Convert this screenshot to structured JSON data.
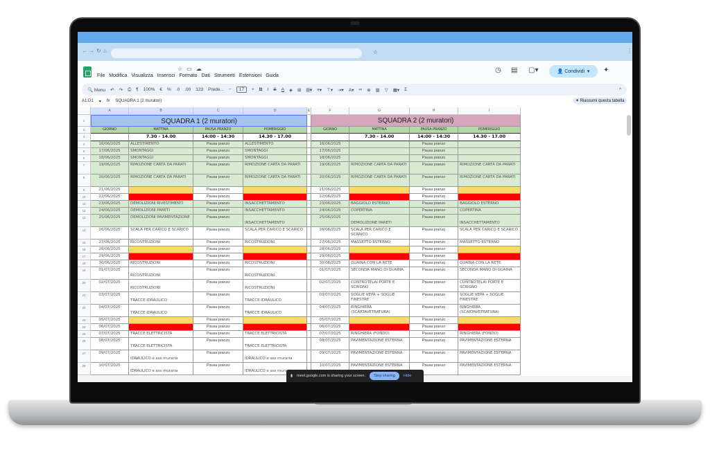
{
  "colors": {
    "green": "#d9ead3",
    "header_green": "#b6d7a8",
    "team1": "#a4c2f4",
    "team2": "#d5a6bd",
    "yellow": "#ffd966",
    "red": "#ff0000",
    "white": "#ffffff"
  },
  "menu": [
    "File",
    "Modifica",
    "Visualizza",
    "Inserisci",
    "Formato",
    "Dati",
    "Strumenti",
    "Estensioni",
    "Guida"
  ],
  "share_label": "Condividi",
  "toolbar": {
    "search": "Menu",
    "zoom": "100%",
    "currency": "€",
    "percent": "%",
    "number": "123",
    "font": "Prede...",
    "font_size": "17"
  },
  "formula": {
    "cell_ref": "A1:D1",
    "fx": "fx",
    "value": "SQUADRA 1 (2 muratori)",
    "summarize": "Riassumi questa tabella"
  },
  "columns": [
    "A",
    "B",
    "C",
    "D",
    "E",
    "F",
    "G",
    "H",
    "I"
  ],
  "team1": {
    "title": "SQUADRA 1 (2 muratori)",
    "headers": [
      "GIORNO",
      "MATTINA",
      "PAUSA PRANZO",
      "POMERIGGIO"
    ],
    "times": [
      "",
      "7.30 - 14.00",
      "14:00 - 14:30",
      "14.30 - 17.00"
    ]
  },
  "team2": {
    "title": "SQUADRA 2 (2 muratori)",
    "headers": [
      "GIORNO",
      "MATTINA",
      "PAUSA PRANZO",
      "POMERIGGIO"
    ],
    "times": [
      "",
      "7.30 - 14.00",
      "14:00 - 14:30",
      "14.30 - 17.00"
    ]
  },
  "lunch": "Pausa pranzo",
  "rows": [
    {
      "n": "4",
      "date": "16/06/2025",
      "fill": "green",
      "s1": [
        "ALLESTIMENTO",
        "ALLESTIMENTO"
      ],
      "s2": [
        "",
        ""
      ]
    },
    {
      "n": "5",
      "date": "17/06/2025",
      "fill": "green",
      "s1": [
        "SMONTAGGI",
        "SMONTAGGI"
      ],
      "s2": [
        "",
        ""
      ]
    },
    {
      "n": "6",
      "date": "18/06/2025",
      "fill": "green",
      "s1": [
        "SMONTAGGI",
        "SMONTAGGI"
      ],
      "s2": [
        "",
        ""
      ]
    },
    {
      "n": "7",
      "date": "19/06/2025",
      "fill": "green",
      "s1": [
        "RIMOZIONE CARTA DA PARATI",
        "RIMOZIONE CARTA DA PARATI"
      ],
      "s2": [
        "RIMOZIONE CARTA DA PARATI",
        "RIMOZIONE CARTA DA PARATI"
      ]
    },
    {
      "n": "8",
      "date": "20/06/2025",
      "fill": "green",
      "s1": [
        "RIMOZIONE CARTA DA PARATI",
        "RIMOZIONE CARTA DA PARATI"
      ],
      "s2": [
        "RIMOZIONE CARTA DA PARATI",
        "RIMOZIONE CARTA DA PARATI"
      ]
    },
    {
      "n": "9",
      "date": "21/06/2025",
      "fill": "yellow",
      "s1": [
        "",
        ""
      ],
      "s2": [
        "",
        ""
      ]
    },
    {
      "n": "10",
      "date": "22/06/2025",
      "fill": "red",
      "s1": [
        "",
        ""
      ],
      "s2": [
        "",
        ""
      ]
    },
    {
      "n": "11",
      "date": "23/06/2025",
      "fill": "green",
      "s1": [
        "DEMOLIZIONI RIVESTIMENTI",
        "INSACCHETTAMENTO"
      ],
      "s2": [
        "BAGGIOLO ESTERNO",
        "BAGGIOLO ESTERNO"
      ]
    },
    {
      "n": "12",
      "date": "24/06/2025",
      "fill": "green",
      "s1": [
        "DEMOLIZIONI PARETI",
        "INSACCHETTAMENTO"
      ],
      "s2": [
        "COPERTINA",
        "COPERTINA"
      ]
    },
    {
      "n": "13",
      "date": "25/06/2025",
      "fill": "green",
      "s1": [
        "DEMOLIZIONI PAVIMENTAZIONE",
        "INSACCHETTAMENTO"
      ],
      "s2": [
        "DEMOLIZIONE PARETI",
        "INSACCHETTAMENTO"
      ]
    },
    {
      "n": "14",
      "date": "26/06/2025",
      "fill": "white",
      "s1": [
        "SCALA PER CARICO E SCARICO",
        "SCALA PER CARICO E SCARICO"
      ],
      "s2": [
        "SCALA PER CARICO E SCARICO",
        "SCALA PER CARICO E SCARICO"
      ]
    },
    {
      "n": "15",
      "date": "27/06/2025",
      "fill": "white",
      "s1": [
        "RICOSTRUZIONI",
        "RICOSTRUZIONI"
      ],
      "s2": [
        "MASSETTO ESTERNO",
        "MASSETTO ESTERNO"
      ]
    },
    {
      "n": "16",
      "date": "28/06/2025",
      "fill": "yellow",
      "s1": [
        "",
        ""
      ],
      "s2": [
        "",
        ""
      ]
    },
    {
      "n": "17",
      "date": "29/06/2025",
      "fill": "red",
      "s1": [
        "",
        ""
      ],
      "s2": [
        "",
        ""
      ]
    },
    {
      "n": "18",
      "date": "30/06/2025",
      "fill": "white",
      "s1": [
        "RICOSTRUZIONI",
        "RICOSTRUZIONI"
      ],
      "s2": [
        "GUAINA CON LA RETE",
        "GUAINA CON LA RETE"
      ]
    },
    {
      "n": "19",
      "date": "01/07/2025",
      "fill": "white",
      "s1": [
        "RICOSTRUZIONI",
        "RICOSTRUZIONI"
      ],
      "s2": [
        "SECONDA MANO DI GUAINA",
        "SECONDA MANO DI GUAINA"
      ]
    },
    {
      "n": "20",
      "date": "02/07/2025",
      "fill": "white",
      "s1": [
        "RICOSTRUZIONI",
        "RICOSTRUZIONI"
      ],
      "s2": [
        "CONTROTELAI PORTE E SCRIGNO",
        "CONTROTELAI PORTE E SCRIGNO"
      ]
    },
    {
      "n": "21",
      "date": "03/07/2025",
      "fill": "white",
      "s1": [
        "TRACCE IDRAULICO",
        "TRACCE IDRAULICO"
      ],
      "s2": [
        "SOGLIE VEPA + SOGLIE FINESTRE",
        "SOGLIE VEPA + SOGLIE FINESTRE"
      ]
    },
    {
      "n": "22",
      "date": "04/07/2025",
      "fill": "white",
      "s1": [
        "TRACCE IDRAULICO",
        "TRACCE IDRAULICO"
      ],
      "s2": [
        "RINGHIERA (SCARTAVETRATURA)",
        "RINGHIERA (SCARTAVETRATURA)"
      ]
    },
    {
      "n": "23",
      "date": "05/07/2025",
      "fill": "yellow",
      "s1": [
        "",
        ""
      ],
      "s2": [
        "",
        ""
      ]
    },
    {
      "n": "24",
      "date": "06/07/2025",
      "fill": "red",
      "s1": [
        "",
        ""
      ],
      "s2": [
        "",
        ""
      ]
    },
    {
      "n": "25",
      "date": "07/07/2025",
      "fill": "white",
      "s1": [
        "TRACCE ELETTRICISTA",
        "TRACCE ELETTRICISTA"
      ],
      "s2": [
        "RINGHIERA (FONDO)",
        "RINGHIERA (FONDO)"
      ]
    },
    {
      "n": "26",
      "date": "08/07/2025",
      "fill": "white",
      "s1": [
        "TRACCE ELETTRICISTA",
        "TRACCE ELETTRICISTA"
      ],
      "s2": [
        "PAVIMENTAZIONE ESTERNA",
        "PAVIMENTAZIONE ESTERNA"
      ]
    },
    {
      "n": "27",
      "date": "09/07/2025",
      "fill": "white",
      "s1": [
        "IDRAULICO e ass muraria",
        "IDRAULICO e ass muraria"
      ],
      "s2": [
        "PAVIMENTAZIONE ESTERNA",
        "PAVIMENTAZIONE ESTERNA"
      ]
    },
    {
      "n": "28",
      "date": "10/07/2025",
      "fill": "white",
      "s1": [
        "IDRAULICO e ass muraria",
        "IDRAULICO e ass muraria"
      ],
      "s2": [
        "PAVIMENTAZIONE ESTERNA",
        "PAVIMENTAZIONE ESTERNA"
      ]
    }
  ],
  "toast": {
    "message": "meet.google.com is sharing your screen.",
    "stop": "Stop sharing",
    "hide": "Hide"
  }
}
